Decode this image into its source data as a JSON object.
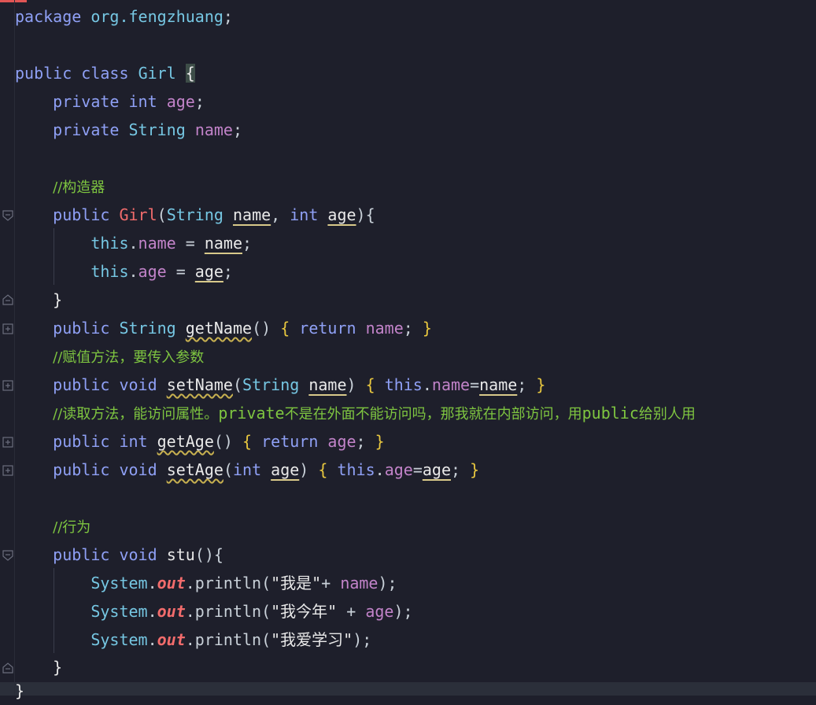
{
  "editor": {
    "lines": {
      "l1": {
        "kw": "package",
        "pkg": "org.fengzhuang",
        "semi": ";"
      },
      "l3": {
        "kw1": "public",
        "kw2": "class",
        "name": "Girl",
        "brace": "{"
      },
      "l4": {
        "kw1": "private",
        "kw2": "int",
        "field": "age",
        "semi": ";"
      },
      "l5": {
        "kw1": "private",
        "type": "String",
        "field": "name",
        "semi": ";"
      },
      "l7": {
        "comment": "//构造器"
      },
      "l8": {
        "kw": "public",
        "name": "Girl",
        "open": "(",
        "type": "String",
        "p1": "name",
        "comma": ", ",
        "kw2": "int",
        "p2": "age",
        "close": "){"
      },
      "l9": {
        "kw": "this",
        "dot": ".",
        "field": "name",
        "eq": " = ",
        "param": "name",
        "semi": ";"
      },
      "l10": {
        "kw": "this",
        "dot": ".",
        "field": "age",
        "eq": " = ",
        "param": "age",
        "semi": ";"
      },
      "l11": {
        "brace": "}"
      },
      "l12": {
        "kw": "public",
        "type": "String",
        "method": "getName",
        "parens": "()",
        "b1": "{",
        "kw2": "return",
        "field": "name",
        "semi": ";",
        "b2": "}"
      },
      "l13": {
        "comment": "//赋值方法，要传入参数"
      },
      "l14": {
        "kw": "public",
        "kw2": "void",
        "method": "setName",
        "open": "(",
        "type": "String",
        "param": "name",
        "close": ")",
        "b1": "{",
        "kw3": "this",
        "dot": ".",
        "field": "name",
        "eq": "=",
        "param2": "name",
        "semi": ";",
        "b2": "}"
      },
      "l15": {
        "c1": "//读取方法，能访问属性。",
        "c2": "private",
        "c3": "不是在外面不能访问吗，那我就在内部访问，用",
        "c4": "public",
        "c5": "给别人用"
      },
      "l16": {
        "kw": "public",
        "kw2": "int",
        "method": "getAge",
        "parens": "()",
        "b1": "{",
        "kw3": "return",
        "field": "age",
        "semi": ";",
        "b2": "}"
      },
      "l17": {
        "kw": "public",
        "kw2": "void",
        "method": "setAge",
        "open": "(",
        "kw3": "int",
        "param": "age",
        "close": ")",
        "b1": "{",
        "kw4": "this",
        "dot": ".",
        "field": "age",
        "eq": "=",
        "param2": "age",
        "semi": ";",
        "b2": "}"
      },
      "l19": {
        "comment": "//行为"
      },
      "l20": {
        "kw": "public",
        "kw2": "void",
        "method": "stu",
        "rest": "(){"
      },
      "l21": {
        "cls": "System",
        "dot": ".",
        "out": "out",
        "call": ".println(",
        "str": "\"我是\"",
        "plus": "+ ",
        "field": "name",
        "end": ");"
      },
      "l22": {
        "cls": "System",
        "dot": ".",
        "out": "out",
        "call": ".println(",
        "str": "\"我今年\"",
        "plus": " + ",
        "field": "age",
        "end": ");"
      },
      "l23": {
        "cls": "System",
        "dot": ".",
        "out": "out",
        "call": ".println(",
        "str": "\"我爱学习\"",
        "end": ");"
      },
      "l24": {
        "brace": "}"
      },
      "l25": {
        "brace": "}"
      }
    }
  },
  "colors": {
    "background": "#1e1f2b",
    "keyword": "#8fa0f5",
    "type": "#76c7e3",
    "field": "#c283c9",
    "comment": "#7ec540",
    "method_decl": "#f26c6c",
    "brace_highlight": "#e8c73f"
  },
  "icons": [
    "fold-open-icon",
    "fold-close-icon",
    "fold-collapsed-icon"
  ]
}
